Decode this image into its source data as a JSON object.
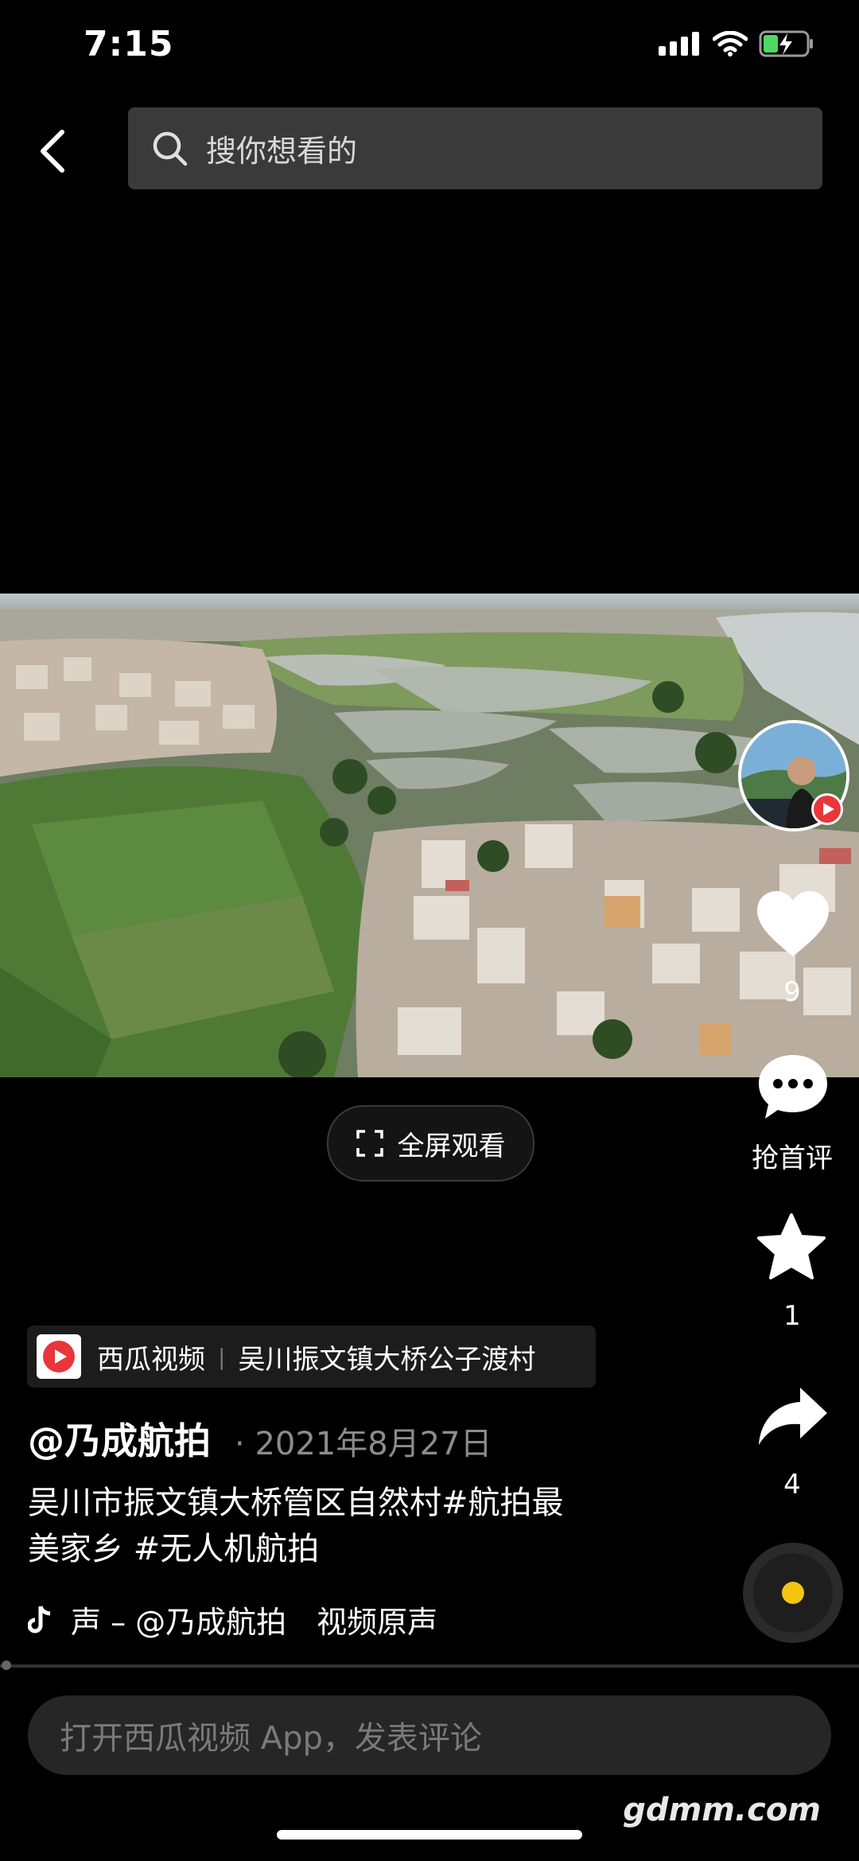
{
  "status_bar": {
    "time": "7:15"
  },
  "search": {
    "placeholder": "搜你想看的"
  },
  "video": {
    "fullscreen_label": "全屏观看"
  },
  "rail": {
    "like_count": "9",
    "comment_label": "抢首评",
    "favorite_count": "1",
    "share_count": "4"
  },
  "source": {
    "app_name": "西瓜视频",
    "location": "吴川振文镇大桥公子渡村"
  },
  "post": {
    "author": "@乃成航拍",
    "date": "2021年8月27日",
    "description_line1": "吴川市振文镇大桥管区自然村#航拍最",
    "description_line2": "美家乡 #无人机航拍",
    "music": "声 – @乃成航拍　视频原声"
  },
  "comment": {
    "placeholder": "打开西瓜视频 App，发表评论"
  },
  "watermark": "gdmm.com",
  "colors": {
    "accent_red": "#e8363a",
    "disc_yellow": "#f2c511",
    "search_bg": "#3a3a3a"
  }
}
